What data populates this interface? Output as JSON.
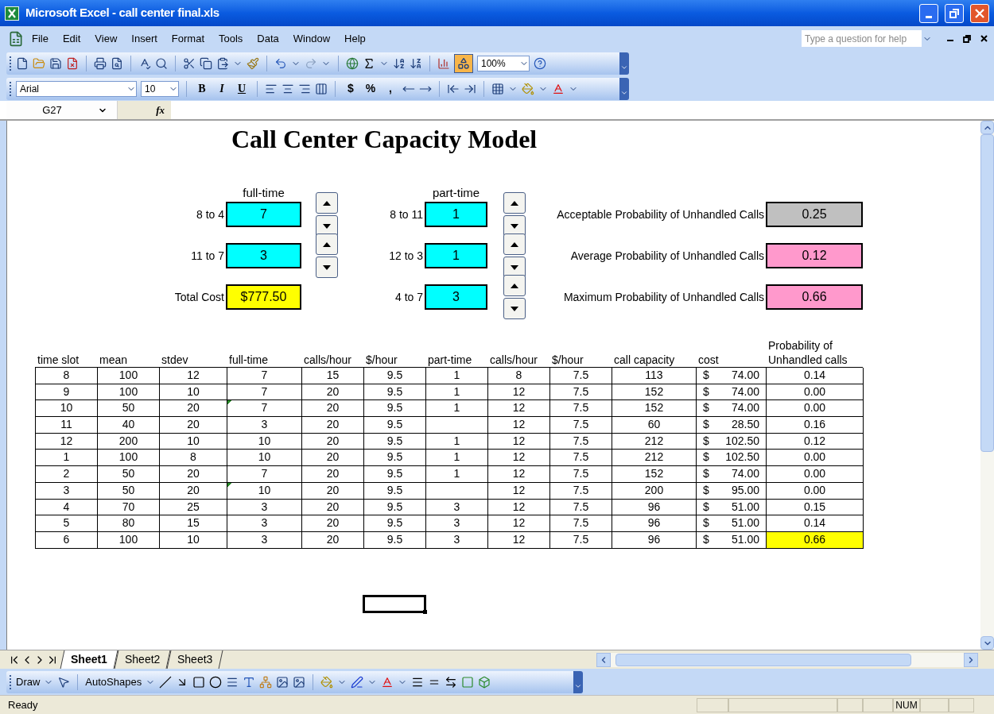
{
  "window": {
    "title": "Microsoft Excel - call center final.xls"
  },
  "menu": [
    "File",
    "Edit",
    "View",
    "Insert",
    "Format",
    "Tools",
    "Data",
    "Window",
    "Help"
  ],
  "help_search": {
    "placeholder": "Type a question for help"
  },
  "standard_toolbar": {
    "zoom": "100%"
  },
  "formatting_toolbar": {
    "font": "Arial",
    "size": "10",
    "style_buttons": [
      "B",
      "I",
      "U"
    ],
    "number_buttons": [
      "$",
      "%",
      ","
    ]
  },
  "formula_bar": {
    "name_box": "G27",
    "function_label": "fx"
  },
  "sheet": {
    "title": "Call Center Capacity Model",
    "full_time": {
      "heading": "full-time",
      "shifts": [
        {
          "label": "8 to 4",
          "value": "7"
        },
        {
          "label": "11 to 7",
          "value": "3"
        }
      ],
      "total": {
        "label": "Total Cost",
        "value": "$777.50"
      }
    },
    "part_time": {
      "heading": "part-time",
      "shifts": [
        {
          "label": "8 to 11",
          "value": "1"
        },
        {
          "label": "12 to 3",
          "value": "1"
        },
        {
          "label": "4 to 7",
          "value": "3"
        }
      ]
    },
    "probabilities": [
      {
        "label": "Acceptable Probability of Unhandled Calls",
        "value": "0.25",
        "kind": "input"
      },
      {
        "label": "Average Probability of Unhandled Calls",
        "value": "0.12",
        "kind": "result"
      },
      {
        "label": "Maximum Probability of Unhandled Calls",
        "value": "0.66",
        "kind": "result"
      }
    ]
  },
  "table": {
    "columns": [
      "time slot",
      "mean",
      "stdev",
      "full-time",
      "calls/hour",
      "$/hour",
      "part-time",
      "calls/hour",
      "$/hour",
      "call capacity",
      "cost",
      "Probability of Unhandled calls"
    ],
    "rows": [
      {
        "cells": [
          "8",
          "100",
          "12",
          "7",
          "15",
          "9.5",
          "1",
          "8",
          "7.5",
          "113",
          "$ 74.00",
          "0.14"
        ],
        "flagged": false,
        "highlighted": false
      },
      {
        "cells": [
          "9",
          "100",
          "10",
          "7",
          "20",
          "9.5",
          "1",
          "12",
          "7.5",
          "152",
          "$ 74.00",
          "0.00"
        ],
        "flagged": false,
        "highlighted": false
      },
      {
        "cells": [
          "10",
          "50",
          "20",
          "7",
          "20",
          "9.5",
          "1",
          "12",
          "7.5",
          "152",
          "$ 74.00",
          "0.00"
        ],
        "flagged": true,
        "highlighted": false
      },
      {
        "cells": [
          "11",
          "40",
          "20",
          "3",
          "20",
          "9.5",
          null,
          "12",
          "7.5",
          "60",
          "$ 28.50",
          "0.16"
        ],
        "flagged": false,
        "highlighted": false
      },
      {
        "cells": [
          "12",
          "200",
          "10",
          "10",
          "20",
          "9.5",
          "1",
          "12",
          "7.5",
          "212",
          "$ 102.50",
          "0.12"
        ],
        "flagged": false,
        "highlighted": false
      },
      {
        "cells": [
          "1",
          "100",
          "8",
          "10",
          "20",
          "9.5",
          "1",
          "12",
          "7.5",
          "212",
          "$ 102.50",
          "0.00"
        ],
        "flagged": false,
        "highlighted": false
      },
      {
        "cells": [
          "2",
          "50",
          "20",
          "7",
          "20",
          "9.5",
          "1",
          "12",
          "7.5",
          "152",
          "$ 74.00",
          "0.00"
        ],
        "flagged": false,
        "highlighted": false
      },
      {
        "cells": [
          "3",
          "50",
          "20",
          "10",
          "20",
          "9.5",
          null,
          "12",
          "7.5",
          "200",
          "$ 95.00",
          "0.00"
        ],
        "flagged": true,
        "highlighted": false
      },
      {
        "cells": [
          "4",
          "70",
          "25",
          "3",
          "20",
          "9.5",
          "3",
          "12",
          "7.5",
          "96",
          "$ 51.00",
          "0.15"
        ],
        "flagged": false,
        "highlighted": false
      },
      {
        "cells": [
          "5",
          "80",
          "15",
          "3",
          "20",
          "9.5",
          "3",
          "12",
          "7.5",
          "96",
          "$ 51.00",
          "0.14"
        ],
        "flagged": false,
        "highlighted": false
      },
      {
        "cells": [
          "6",
          "100",
          "10",
          "3",
          "20",
          "9.5",
          "3",
          "12",
          "7.5",
          "96",
          "$ 51.00",
          "0.66"
        ],
        "flagged": false,
        "highlighted": true
      }
    ]
  },
  "sheet_tabs": [
    {
      "label": "Sheet1",
      "selected": true
    },
    {
      "label": "Sheet2",
      "selected": false
    },
    {
      "label": "Sheet3",
      "selected": false
    }
  ],
  "draw_toolbar": {
    "draw": "Draw",
    "autoshapes": "AutoShapes"
  },
  "status_bar": {
    "text": "Ready",
    "indicators": [
      "NUM"
    ]
  }
}
